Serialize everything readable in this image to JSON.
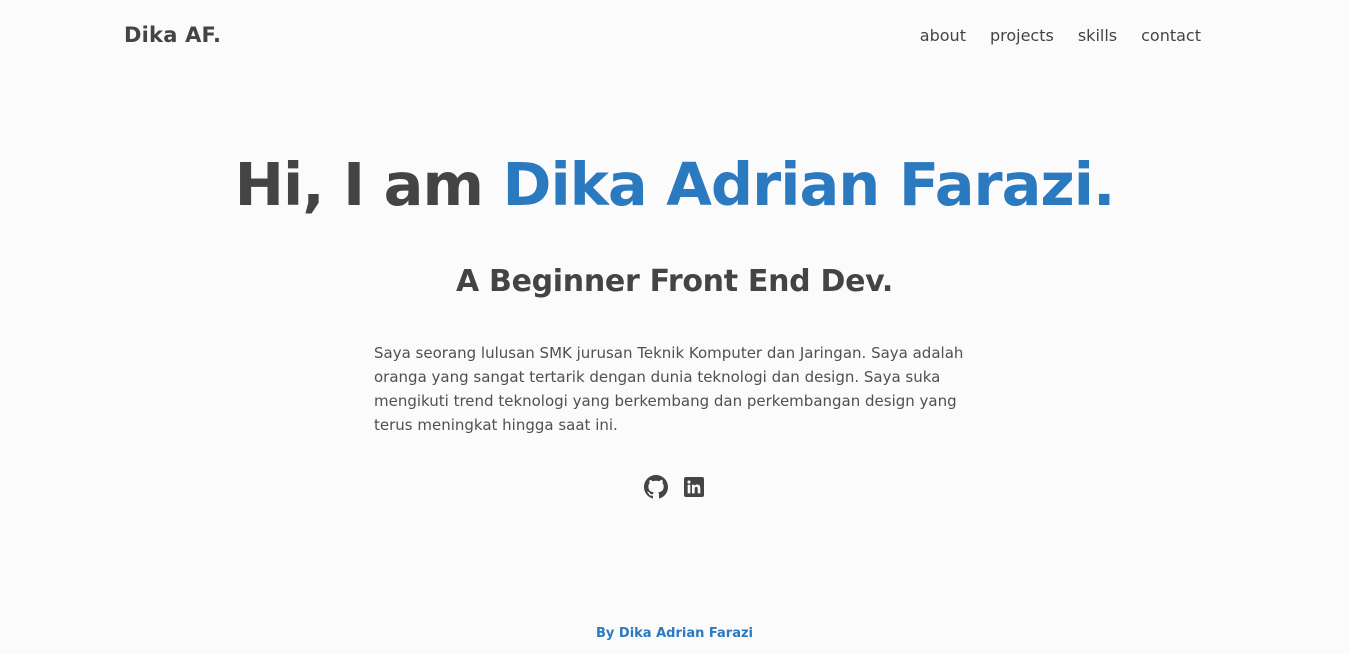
{
  "header": {
    "brand": "Dika AF.",
    "nav": [
      {
        "label": "about"
      },
      {
        "label": "projects"
      },
      {
        "label": "skills"
      },
      {
        "label": "contact"
      }
    ]
  },
  "hero": {
    "greeting": "Hi, I am ",
    "name": "Dika Adrian Farazi.",
    "subtitle": "A Beginner Front End Dev.",
    "description": "Saya seorang lulusan SMK jurusan Teknik Komputer dan Jaringan. Saya adalah oranga yang sangat tertarik dengan dunia teknologi dan design. Saya suka mengikuti trend teknologi yang berkembang dan perkembangan design yang terus meningkat hingga saat ini."
  },
  "social": {
    "icons": [
      "github-icon",
      "linkedin-icon"
    ]
  },
  "footer": {
    "text": "By Dika Adrian Farazi"
  },
  "colors": {
    "text": "#444444",
    "accent": "#2b79be",
    "background": "#fbfbfb"
  }
}
